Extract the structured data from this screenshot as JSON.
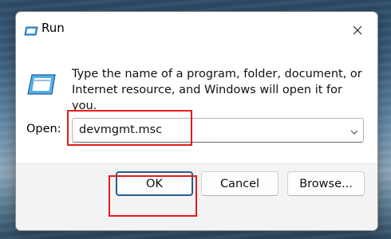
{
  "dialog": {
    "title": "Run",
    "description": "Type the name of a program, folder, document, or Internet resource, and Windows will open it for you.",
    "open_label": "Open:",
    "open_value": "devmgmt.msc"
  },
  "buttons": {
    "ok": "OK",
    "cancel": "Cancel",
    "browse": "Browse..."
  },
  "icons": {
    "title": "run-icon",
    "content": "run-icon",
    "close": "close-icon",
    "dropdown": "chevron-down-icon"
  },
  "colors": {
    "highlight": "#e41c1c",
    "ok_border": "#1f5e93"
  }
}
